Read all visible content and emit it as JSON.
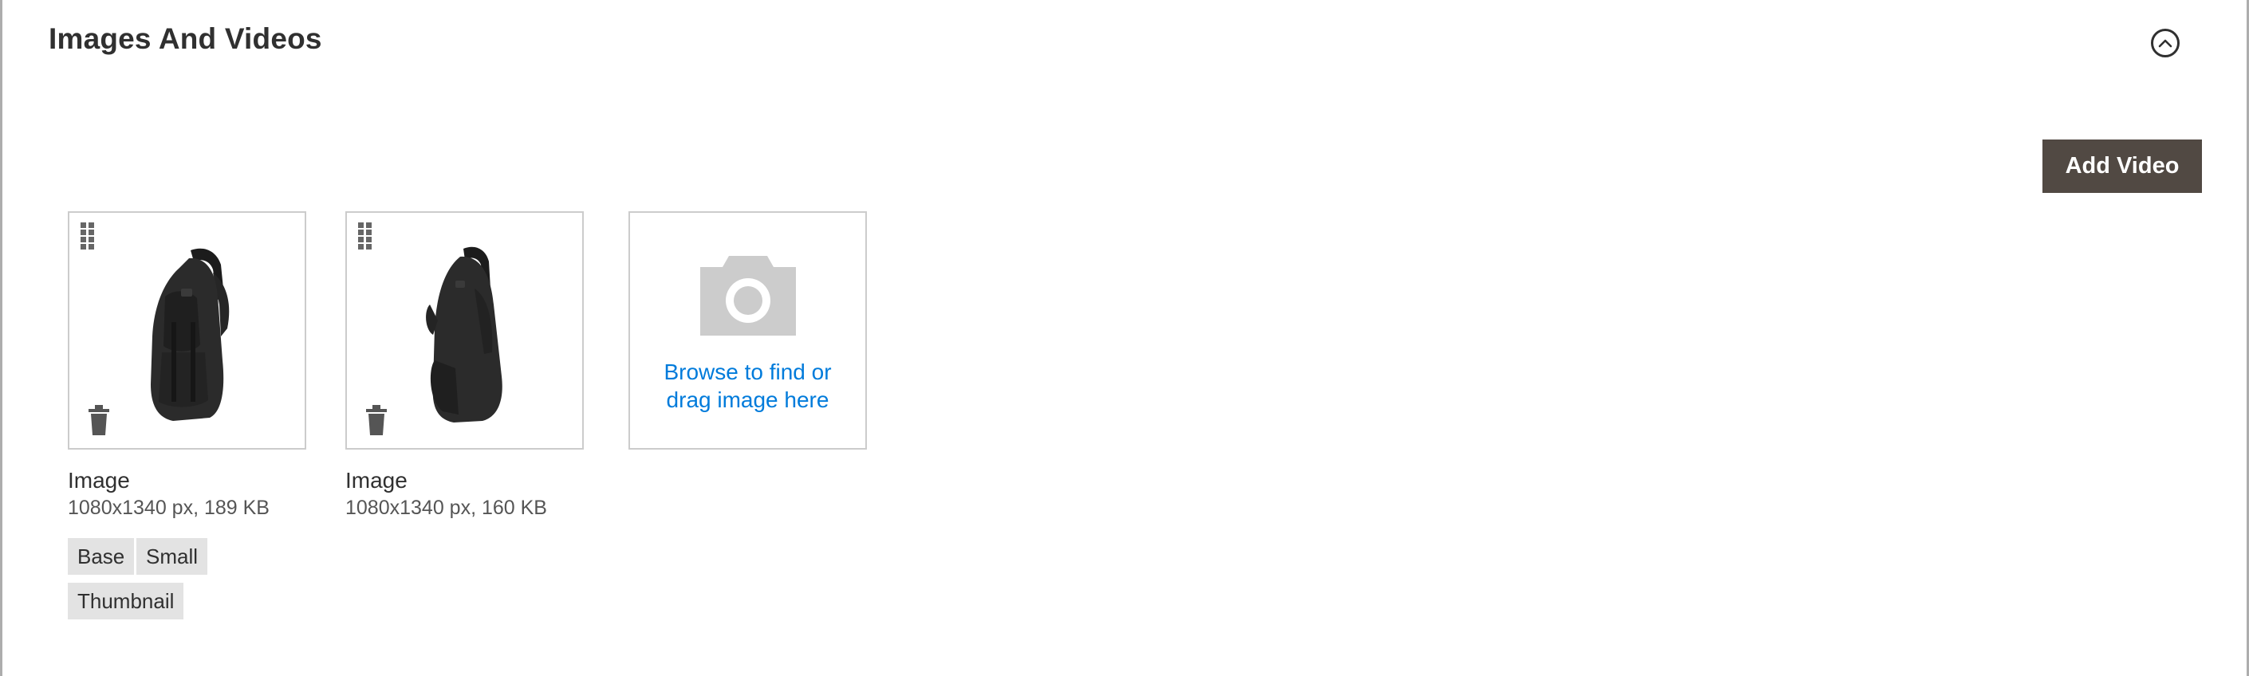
{
  "section": {
    "title": "Images And Videos"
  },
  "toolbar": {
    "add_video_label": "Add Video"
  },
  "images": [
    {
      "label": "Image",
      "meta": "1080x1340 px, 189 KB",
      "roles": [
        "Base",
        "Small",
        "Thumbnail"
      ]
    },
    {
      "label": "Image",
      "meta": "1080x1340 px, 160 KB",
      "roles": []
    }
  ],
  "uploader": {
    "line1": "Browse to find or",
    "line2": "drag image here"
  },
  "colors": {
    "accent_link": "#007bdb",
    "button_bg": "#514943",
    "tag_bg": "#e3e3e3",
    "tile_border": "#cccccc"
  },
  "icons": {
    "collapse": "chevron-up-icon",
    "drag": "drag-handle-icon",
    "delete": "trash-icon",
    "upload": "camera-icon"
  }
}
